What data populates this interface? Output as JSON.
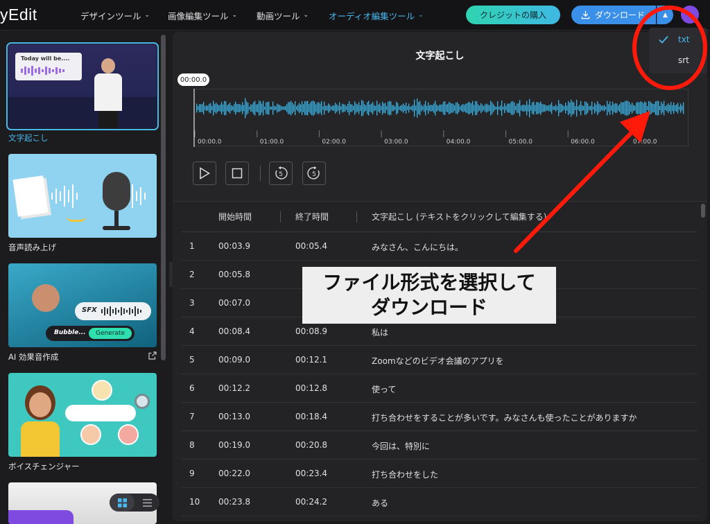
{
  "topbar": {
    "logo": "yEdit",
    "nav": [
      {
        "label": "デザインツール"
      },
      {
        "label": "画像編集ツール"
      },
      {
        "label": "動画ツール"
      },
      {
        "label": "オーディオ編集ツール"
      }
    ],
    "credit_button": "クレジットの購入",
    "download_button": "ダウンロード",
    "accent": "#49b8ef"
  },
  "sidebar": {
    "cards": [
      {
        "label": "文字起こし",
        "overlay": "Today will be...."
      },
      {
        "label": "音声読み上げ"
      },
      {
        "label": "AI 効果音作成",
        "sfx": "SFX",
        "prompt": "Bubble...",
        "generate": "Generate"
      },
      {
        "label": "ボイスチェンジャー"
      }
    ]
  },
  "main": {
    "title": "文字起こし",
    "current_time": "00:00.0",
    "timeline_ticks": [
      "00:00.0",
      "01:00.0",
      "02:00.0",
      "03:00.0",
      "04:00.0",
      "05:00.0",
      "06:00.0",
      "07:00.0"
    ],
    "controls": {
      "rewind_seconds": "5",
      "forward_seconds": "5"
    },
    "table": {
      "headers": [
        "開始時間",
        "終了時間",
        "文字起こし (テキストをクリックして編集する)"
      ],
      "rows": [
        {
          "no": "1",
          "start": "00:03.9",
          "end": "00:05.4",
          "text": "みなさん、こんにちは。"
        },
        {
          "no": "2",
          "start": "00:05.8",
          "end": "",
          "text": ""
        },
        {
          "no": "3",
          "start": "00:07.0",
          "end": "",
          "text": ""
        },
        {
          "no": "4",
          "start": "00:08.4",
          "end": "00:08.9",
          "text": "私は"
        },
        {
          "no": "5",
          "start": "00:09.0",
          "end": "00:12.1",
          "text": "Zoomなどのビデオ会議のアプリを"
        },
        {
          "no": "6",
          "start": "00:12.2",
          "end": "00:12.8",
          "text": "使って"
        },
        {
          "no": "7",
          "start": "00:13.0",
          "end": "00:18.4",
          "text": "打ち合わせをすることが多いです。みなさんも使ったことがありますか"
        },
        {
          "no": "8",
          "start": "00:19.0",
          "end": "00:20.8",
          "text": "今回は、特別に"
        },
        {
          "no": "9",
          "start": "00:22.0",
          "end": "00:23.4",
          "text": "打ち合わせをした"
        },
        {
          "no": "10",
          "start": "00:23.8",
          "end": "00:24.2",
          "text": "ある"
        }
      ]
    }
  },
  "dropdown": {
    "items": [
      {
        "label": "txt",
        "checked": true
      },
      {
        "label": "srt",
        "checked": false
      }
    ]
  },
  "annotation": {
    "line1": "ファイル形式を選択して",
    "line2": "ダウンロード",
    "color": "#ff1a0a"
  }
}
